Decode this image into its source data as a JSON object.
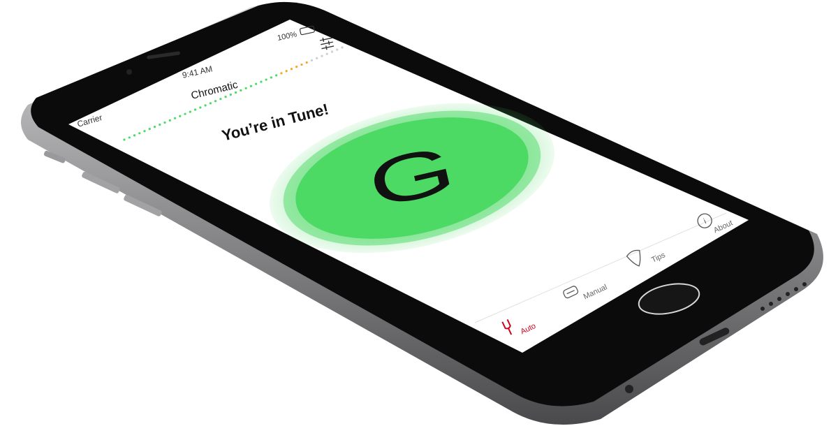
{
  "status_bar": {
    "carrier": "Carrier",
    "time": "9:41 AM",
    "battery": "100%"
  },
  "header": {
    "mode_label": "Chromatic",
    "settings_icon": "sliders-icon"
  },
  "tuner": {
    "status_text": "You’re in Tune!",
    "note": "G",
    "in_tune": true
  },
  "tab_bar": {
    "tabs": [
      {
        "label": "Auto",
        "icon": "tuning-fork-icon",
        "active": true
      },
      {
        "label": "Manual",
        "icon": "guitar-headstock-icon",
        "active": false
      },
      {
        "label": "Tips",
        "icon": "guitar-pick-icon",
        "active": false
      },
      {
        "label": "About",
        "icon": "info-icon",
        "active": false
      }
    ]
  },
  "colors": {
    "accent_red": "#d0021b",
    "in_tune_green": "#4cd964",
    "meter_orange": "#f5a623"
  }
}
